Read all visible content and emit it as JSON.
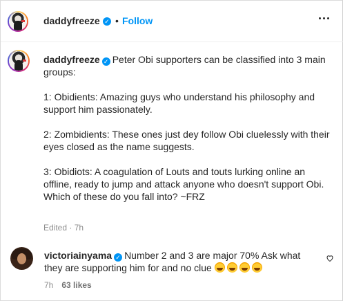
{
  "header": {
    "username": "daddyfreeze",
    "separator": "•",
    "follow_label": "Follow"
  },
  "post": {
    "username": "daddyfreeze",
    "caption": "Peter Obi supporters can be classified into 3 main groups:\n\n1: Obidients: Amazing guys who understand his philosophy and support him passionately.\n\n2: Zombidients: These ones just dey follow Obi cluelessly with their eyes closed as the name suggests.\n\n3: Obidiots: A coagulation of Louts and touts lurking online an offline, ready to jump and attack anyone who doesn't support Obi.\nWhich of these do you fall into? ~FRZ",
    "meta": "Edited · 7h"
  },
  "comment": {
    "username": "victoriainyama",
    "text": "Number 2 and 3 are major 70% Ask what they are supporting him for and no clue",
    "emoji_count": 4,
    "time": "7h",
    "likes": "63 likes"
  },
  "icons": {
    "verified": "verified-badge-icon",
    "more": "more-options-icon",
    "heart": "heart-icon",
    "emoji": "laughing-emoji-icon"
  },
  "colors": {
    "accent": "#0095f6",
    "text": "#262626",
    "muted": "#8e8e8e"
  }
}
